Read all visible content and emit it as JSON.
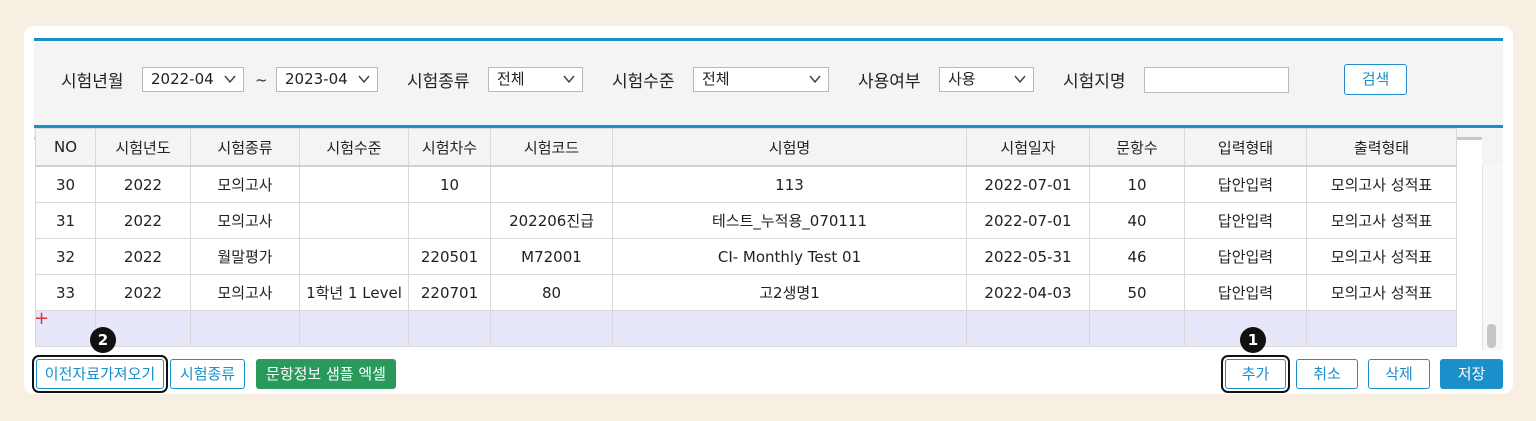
{
  "filters": {
    "year_month_label": "시험년월",
    "from_value": "2022-04",
    "range_sep": "~",
    "to_value": "2023-04",
    "type_label": "시험종류",
    "type_value": "전체",
    "level_label": "시험수준",
    "level_value": "전체",
    "use_label": "사용여부",
    "use_value": "사용",
    "name_label": "시험지명",
    "name_value": "",
    "search_label": "검색"
  },
  "table": {
    "columns": [
      "NO",
      "시험년도",
      "시험종류",
      "시험수준",
      "시험차수",
      "시험코드",
      "시험명",
      "시험일자",
      "문항수",
      "입력형태",
      "출력형태"
    ],
    "rows": [
      [
        "30",
        "2022",
        "모의고사",
        "",
        "10",
        "",
        "113",
        "2022-07-01",
        "10",
        "답안입력",
        "모의고사 성적표"
      ],
      [
        "31",
        "2022",
        "모의고사",
        "",
        "",
        "202206진급",
        "테스트_누적용_070111",
        "2022-07-01",
        "40",
        "답안입력",
        "모의고사 성적표"
      ],
      [
        "32",
        "2022",
        "월말평가",
        "",
        "220501",
        "M72001",
        "CI- Monthly Test 01",
        "2022-05-31",
        "46",
        "답안입력",
        "모의고사 성적표"
      ],
      [
        "33",
        "2022",
        "모의고사",
        "1학년 1 Level",
        "220701",
        "80",
        "고2생명1",
        "2022-04-03",
        "50",
        "답안입력",
        "모의고사 성적표"
      ]
    ],
    "new_row_marker": "+"
  },
  "toolbar": {
    "import_prev_label": "이전자료가져오기",
    "exam_type_label": "시험종류",
    "sample_excel_label": "문항정보 샘플 엑셀",
    "add_label": "추가",
    "cancel_label": "취소",
    "delete_label": "삭제",
    "save_label": "저장"
  },
  "annotations": {
    "badge_1": "1",
    "badge_2": "2"
  },
  "colors": {
    "accent": "#1a8fc9",
    "excel_green": "#2a9a5c",
    "new_row": "#e6e7f8",
    "background": "#f8efe3"
  }
}
